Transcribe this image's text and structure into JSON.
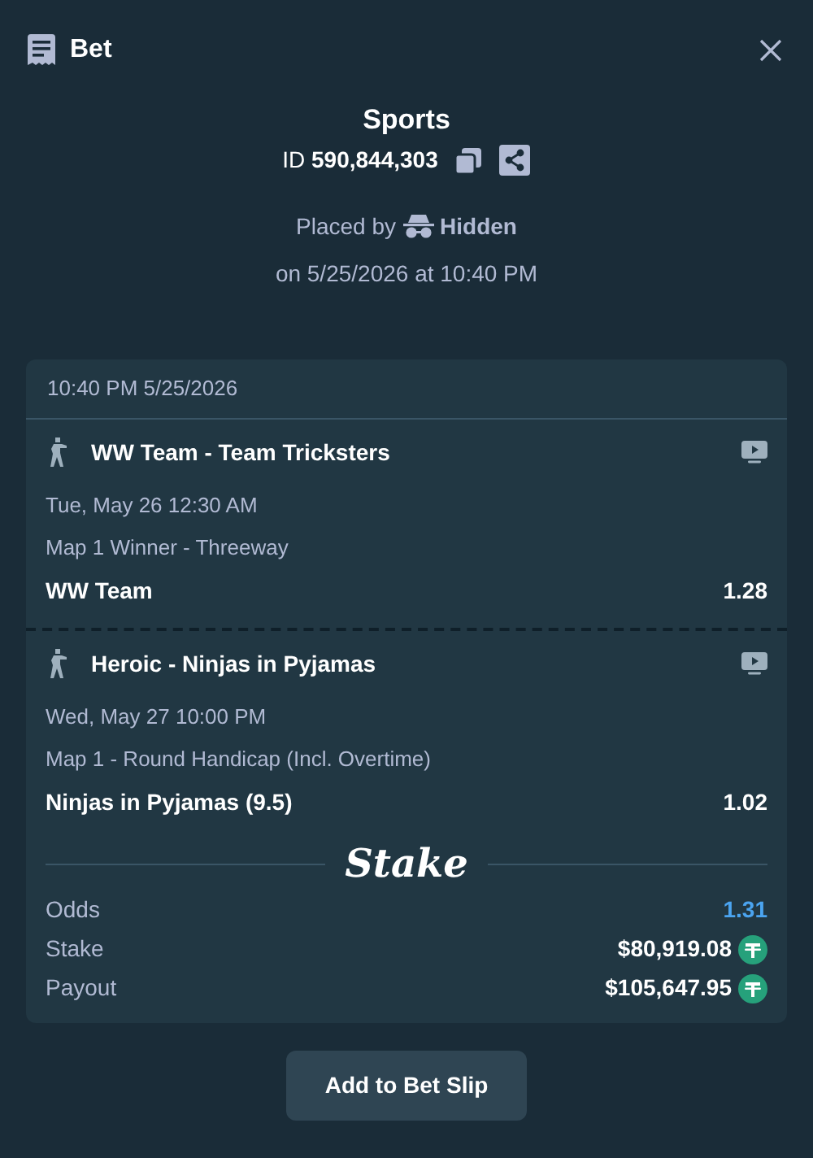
{
  "header": {
    "title": "Bet"
  },
  "summary": {
    "category": "Sports",
    "id_label": "ID",
    "id_value": "590,844,303",
    "placed_by_label": "Placed by",
    "user": "Hidden",
    "placed_on": "on 5/25/2026 at 10:40 PM"
  },
  "card": {
    "timestamp": "10:40 PM 5/25/2026",
    "legs": [
      {
        "match": "WW Team - Team Tricksters",
        "start": "Tue, May 26  12:30 AM",
        "market": "Map 1 Winner - Threeway",
        "outcome": "WW Team",
        "odds": "1.28"
      },
      {
        "match": "Heroic - Ninjas in Pyjamas",
        "start": "Wed, May 27  10:00 PM",
        "market": "Map 1 - Round Handicap (Incl. Overtime)",
        "outcome": "Ninjas in Pyjamas (9.5)",
        "odds": "1.02"
      }
    ],
    "logo": "Stake",
    "totals": [
      {
        "kind": "odds",
        "label": "Odds",
        "value": "1.31"
      },
      {
        "kind": "amount",
        "label": "Stake",
        "value": "$80,919.08"
      },
      {
        "kind": "amount",
        "label": "Payout",
        "value": "$105,647.95"
      }
    ]
  },
  "button": "Add to Bet Slip"
}
